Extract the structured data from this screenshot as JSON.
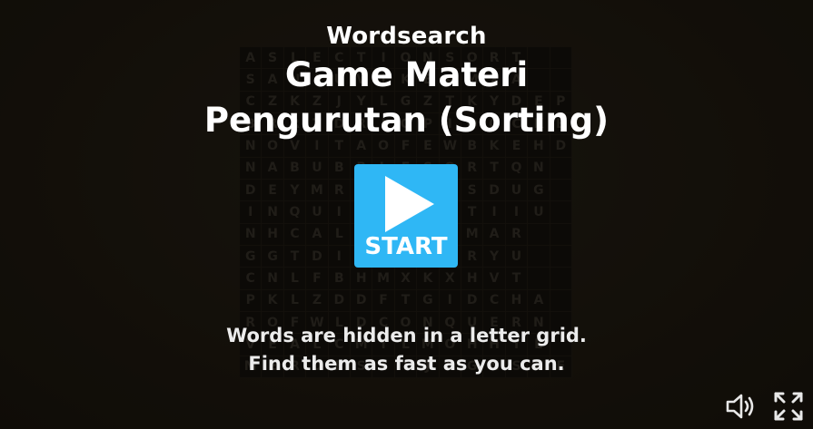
{
  "header": {
    "game_type": "Wordsearch",
    "title_line1": "Game Materi",
    "title_line2": "Pengurutan (Sorting)"
  },
  "start": {
    "label": "START"
  },
  "instructions": {
    "line1": "Words are hidden in a letter grid.",
    "line2": "Find them as fast as you can."
  },
  "grid_rows": [
    "ASLECTIONSORT",
    "SANIUVIKEAMXA",
    "CZKZJYLGZTKYDEP",
    "BRRTDRIGPIOOCKB",
    "NOVITAOFEWBKEHD",
    "NABUBBLESORTQN",
    "DEYMRLOYNMSDUG",
    "INQUIRATMRTIIU",
    "NHCALERUITMAR",
    "GGTDIFUNYTRYU",
    "CNLFBHMXKXHVT",
    "PKLZDDFTGIDCHA",
    "ROFWLDCONQUERN",
    "VEALCMILMOHHTE",
    "MEROESIIJEGNSEE"
  ],
  "controls": {
    "sound_icon": "speaker-icon",
    "fullscreen_icon": "fullscreen-icon"
  },
  "colors": {
    "accent": "#2fb7f5",
    "background": "#17130c"
  }
}
